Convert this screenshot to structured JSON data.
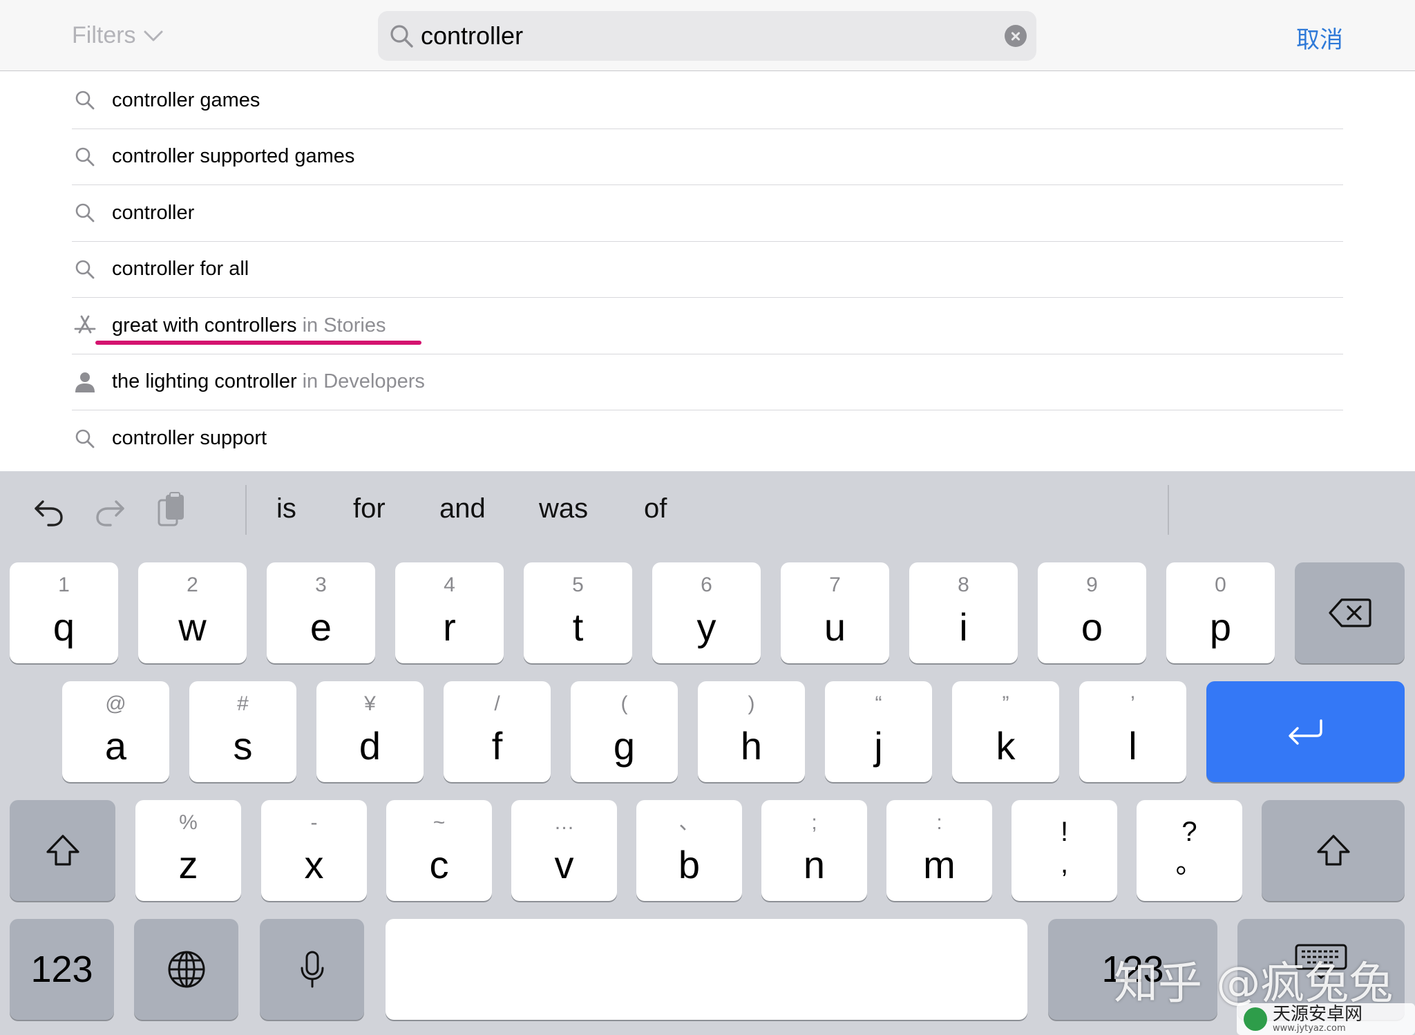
{
  "header": {
    "filters_label": "Filters",
    "search_value": "controller",
    "cancel_label": "取消"
  },
  "suggestions": [
    {
      "icon": "search-icon",
      "text": "controller games",
      "scope": ""
    },
    {
      "icon": "search-icon",
      "text": "controller supported games",
      "scope": ""
    },
    {
      "icon": "search-icon",
      "text": "controller",
      "scope": ""
    },
    {
      "icon": "search-icon",
      "text": "controller for all",
      "scope": ""
    },
    {
      "icon": "app-store-icon",
      "text": "great with controllers",
      "scope": "in Stories"
    },
    {
      "icon": "person-icon",
      "text": "the lighting controller",
      "scope": "in Developers"
    },
    {
      "icon": "search-icon",
      "text": "controller support",
      "scope": ""
    }
  ],
  "annotation": {
    "color": "#d4136f"
  },
  "keyboard": {
    "predictions": [
      "is",
      "for",
      "and",
      "was",
      "of"
    ],
    "row1": [
      {
        "sub": "1",
        "main": "q"
      },
      {
        "sub": "2",
        "main": "w"
      },
      {
        "sub": "3",
        "main": "e"
      },
      {
        "sub": "4",
        "main": "r"
      },
      {
        "sub": "5",
        "main": "t"
      },
      {
        "sub": "6",
        "main": "y"
      },
      {
        "sub": "7",
        "main": "u"
      },
      {
        "sub": "8",
        "main": "i"
      },
      {
        "sub": "9",
        "main": "o"
      },
      {
        "sub": "0",
        "main": "p"
      }
    ],
    "row2": [
      {
        "sub": "@",
        "main": "a"
      },
      {
        "sub": "#",
        "main": "s"
      },
      {
        "sub": "¥",
        "main": "d"
      },
      {
        "sub": "/",
        "main": "f"
      },
      {
        "sub": "(",
        "main": "g"
      },
      {
        "sub": ")",
        "main": "h"
      },
      {
        "sub": "“",
        "main": "j"
      },
      {
        "sub": "”",
        "main": "k"
      },
      {
        "sub": "’",
        "main": "l"
      }
    ],
    "row3": [
      {
        "sub": "%",
        "main": "z"
      },
      {
        "sub": "-",
        "main": "x"
      },
      {
        "sub": "~",
        "main": "c"
      },
      {
        "sub": "…",
        "main": "v"
      },
      {
        "sub": "、",
        "main": "b"
      },
      {
        "sub": ";",
        "main": "n"
      },
      {
        "sub": ":",
        "main": "m"
      }
    ],
    "punct_keys": [
      {
        "top": "!",
        "bottom": ","
      },
      {
        "top": "?",
        "bottom": "。"
      }
    ],
    "numbers_label": "123",
    "numbers_label_right": "123",
    "accent": "#3478f6"
  },
  "watermark": {
    "text": "知乎 @疯兔兔",
    "site_name": "天源安卓网",
    "site_url": "www.jytyaz.com"
  }
}
